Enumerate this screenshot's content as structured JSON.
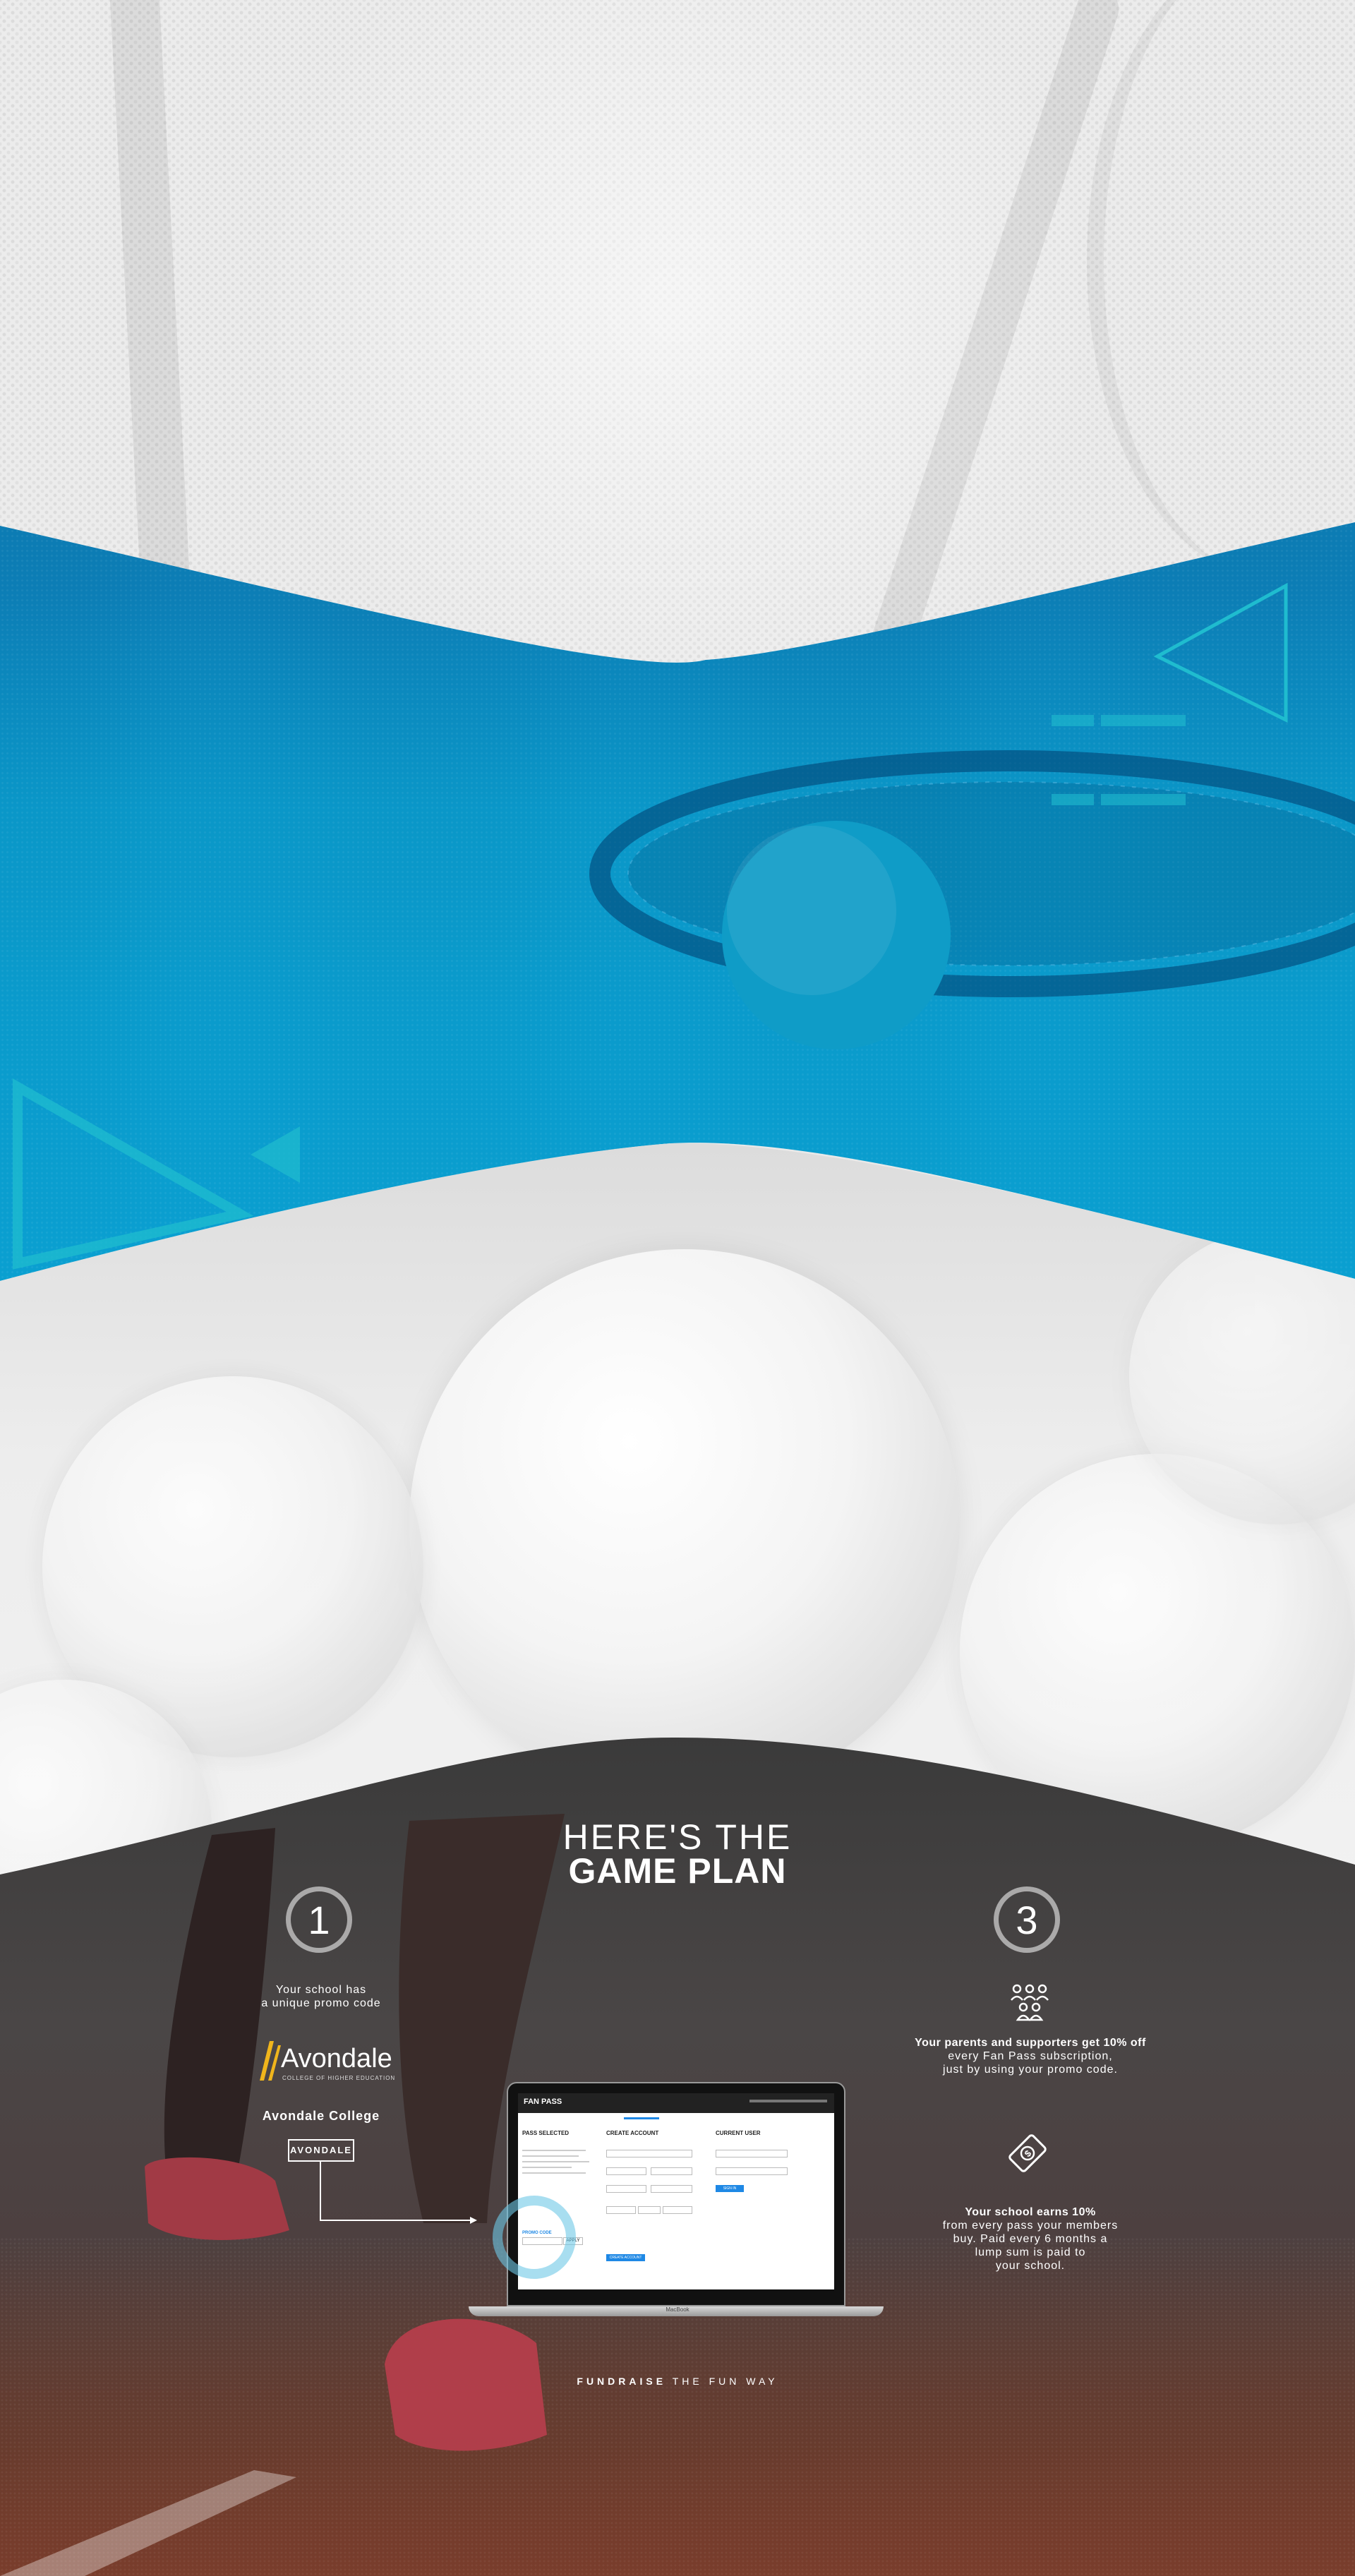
{
  "heading": {
    "line1": "HERE'S THE",
    "line2": "GAME PLAN"
  },
  "step1": {
    "number": "1",
    "text_line1": "Your school has",
    "text_line2": "a unique promo code",
    "logo_name": "Avondale",
    "logo_tagline": "COLLEGE OF HIGHER EDUCATION",
    "school_name": "Avondale College",
    "promo_code": "AVONDALE"
  },
  "step3": {
    "number": "3",
    "bold_line": "Your parents and supporters get 10% off",
    "line2": "every Fan Pass subscription,",
    "line3": "just by using your promo code.",
    "icon": "group-of-people-icon"
  },
  "earn": {
    "icon": "money-icon",
    "bold_line": "Your school earns 10%",
    "line2": "from every pass your members",
    "line3": "buy. Paid every 6 months a",
    "line4": "lump sum is paid to",
    "line5": "your school."
  },
  "laptop": {
    "brand": "MacBook",
    "app_title": "FAN PASS",
    "col1_title": "PASS SELECTED",
    "col2_title": "CREATE ACCOUNT",
    "col3_title": "CURRENT USER",
    "promo_label": "PROMO CODE",
    "apply_label": "APPLY",
    "create_label": "CREATE ACCOUNT",
    "signin_label": "SIGN IN"
  },
  "tagline": {
    "bold": "FUNDRAISE",
    "rest": " THE FUN WAY"
  },
  "colors": {
    "blue": "#0a7db5",
    "teal": "#1fbccf",
    "dark": "#3f3c3c"
  }
}
